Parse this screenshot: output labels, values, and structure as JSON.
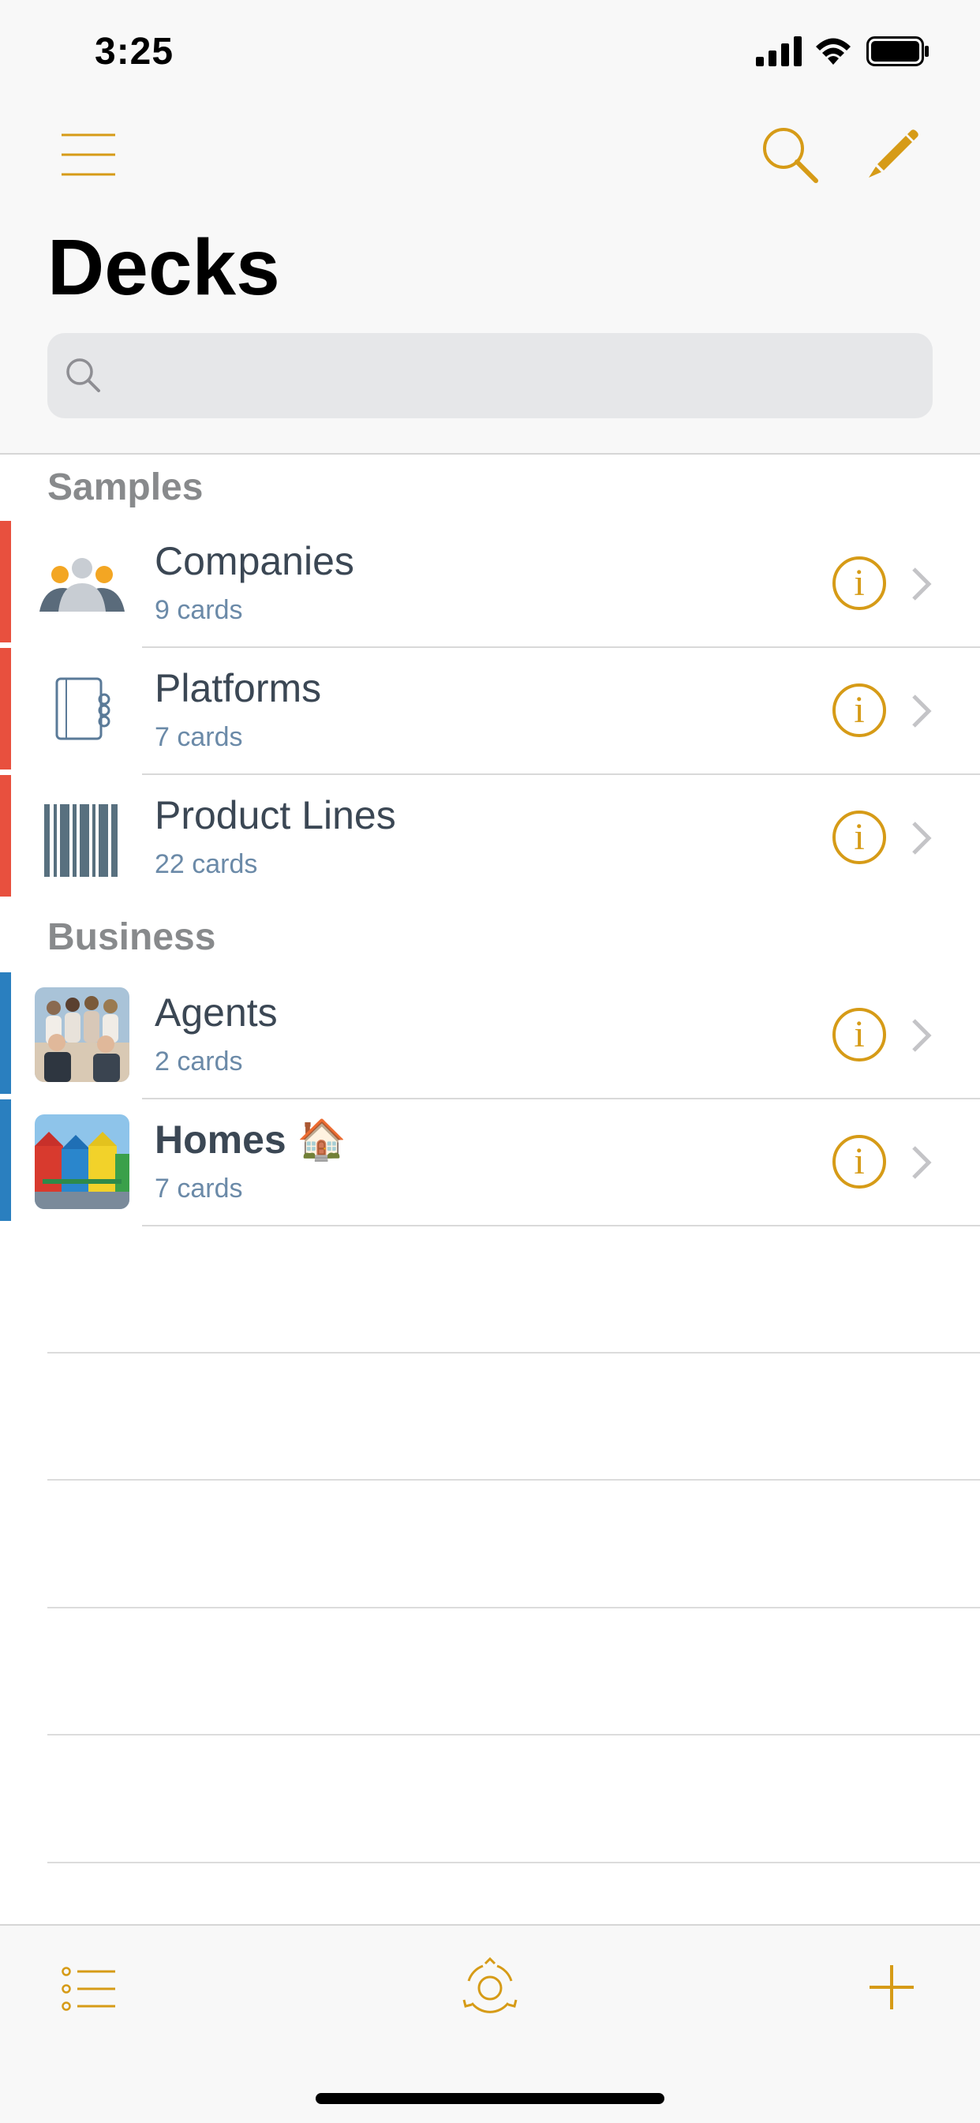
{
  "status_bar": {
    "time": "3:25"
  },
  "nav": {
    "title": "Decks",
    "search_placeholder": ""
  },
  "sections": [
    {
      "header": "Samples",
      "accent": "#e8503e",
      "items": [
        {
          "name": "Companies",
          "count": "9 cards",
          "icon": "people-icon"
        },
        {
          "name": "Platforms",
          "count": "7 cards",
          "icon": "notebook-icon"
        },
        {
          "name": "Product Lines",
          "count": "22 cards",
          "icon": "barcode-icon"
        }
      ]
    },
    {
      "header": "Business",
      "accent": "#2a7fbf",
      "items": [
        {
          "name": "Agents",
          "count": "2 cards",
          "icon": "agents-photo"
        },
        {
          "name": "Homes 🏠",
          "count": "7 cards",
          "icon": "homes-photo"
        }
      ]
    }
  ],
  "colors": {
    "accent_gold": "#d69b17",
    "text": "#3b4754",
    "subtext": "#6b8aa8",
    "samples_marker": "#e8503e",
    "business_marker": "#2a7fbf"
  }
}
